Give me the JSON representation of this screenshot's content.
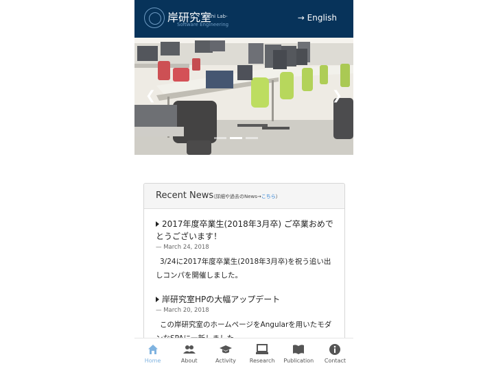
{
  "header": {
    "logo_tiny": "Software Engineering",
    "logo_title": "岸研究室",
    "logo_sub": "-Kishi Lab-",
    "logo_tag": "Software Engineering",
    "lang_link": "→ English"
  },
  "carousel": {
    "prev_icon": "chevron-left-icon",
    "next_icon": "chevron-right-icon",
    "prev_glyph": "❮",
    "next_glyph": "❯",
    "slides": 3,
    "active_slide": 2
  },
  "news": {
    "heading": "Recent News",
    "note_prefix": "（詳細や過去のNews→",
    "note_link": "こちら",
    "note_suffix": "）",
    "items": [
      {
        "title": "2017年度卒業生(2018年3月卒) ご卒業おめでとうございます！",
        "date": "— March 24, 2018",
        "body": "3/24に2017年度卒業生(2018年3月卒)を祝う追い出しコンパを開催しました。"
      },
      {
        "title": "岸研究室HPの大幅アップデート",
        "date": "— March 20, 2018",
        "body": "この岸研究室のホームページをAngularを用いたモダンなSPAに一新しました。"
      }
    ]
  },
  "nav": {
    "items": [
      {
        "label": "Home",
        "icon": "home-icon"
      },
      {
        "label": "About",
        "icon": "people-icon"
      },
      {
        "label": "Activity",
        "icon": "graduation-cap-icon"
      },
      {
        "label": "Research",
        "icon": "laptop-icon"
      },
      {
        "label": "Publication",
        "icon": "book-icon"
      },
      {
        "label": "Contact",
        "icon": "info-icon"
      }
    ],
    "active_color": "#7fb3e0",
    "inactive_color": "#555555"
  },
  "colors": {
    "header_bg": "#07335a",
    "link": "#2a7fd4"
  }
}
